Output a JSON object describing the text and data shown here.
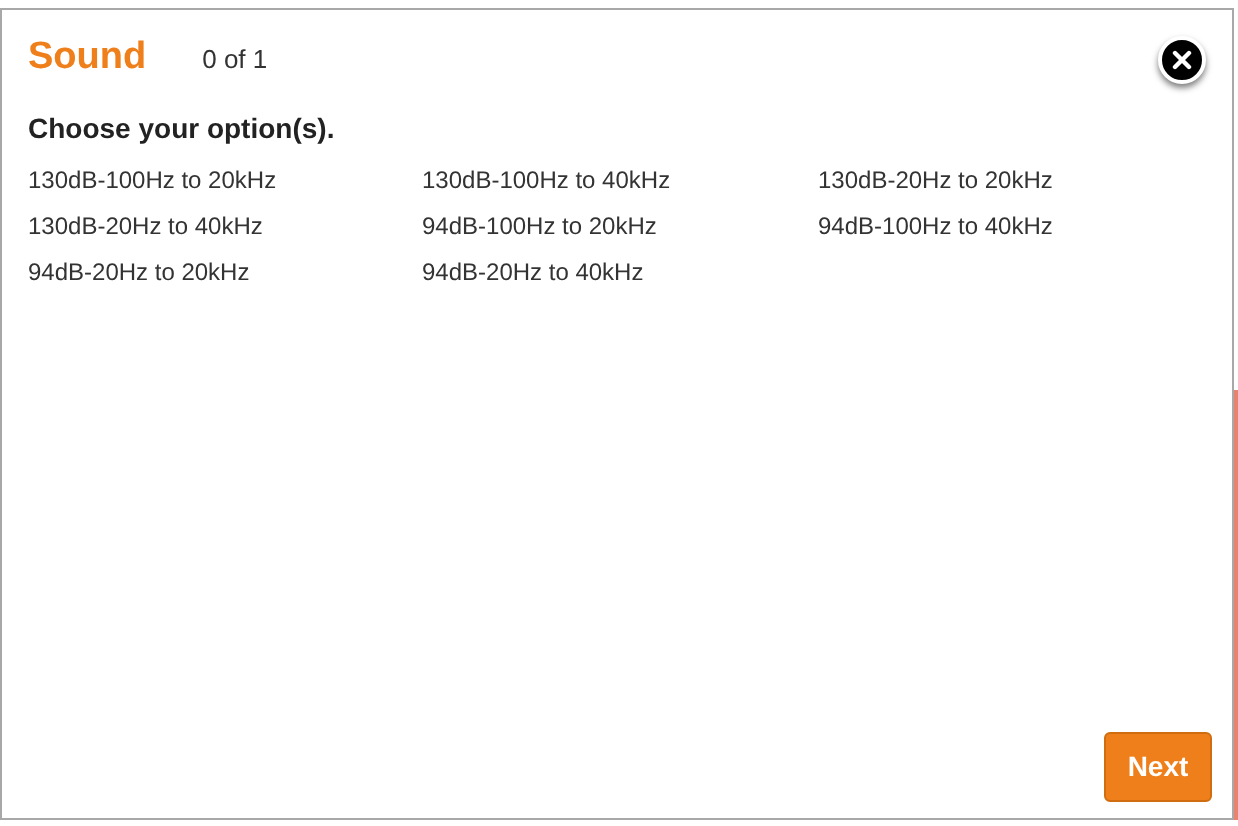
{
  "dialog": {
    "title": "Sound",
    "counter": "0 of 1",
    "prompt": "Choose your option(s).",
    "options": [
      {
        "label": "130dB-100Hz to 20kHz",
        "selected": false
      },
      {
        "label": "130dB-100Hz to 40kHz",
        "selected": false
      },
      {
        "label": "130dB-20Hz to 20kHz",
        "selected": false
      },
      {
        "label": "130dB-20Hz to 40kHz",
        "selected": false
      },
      {
        "label": "94dB-100Hz to 20kHz",
        "selected": false
      },
      {
        "label": "94dB-100Hz to 40kHz",
        "selected": false
      },
      {
        "label": "94dB-20Hz to 20kHz",
        "selected": false
      },
      {
        "label": "94dB-20Hz to 40kHz",
        "selected": false
      }
    ],
    "next_button": "Next"
  }
}
